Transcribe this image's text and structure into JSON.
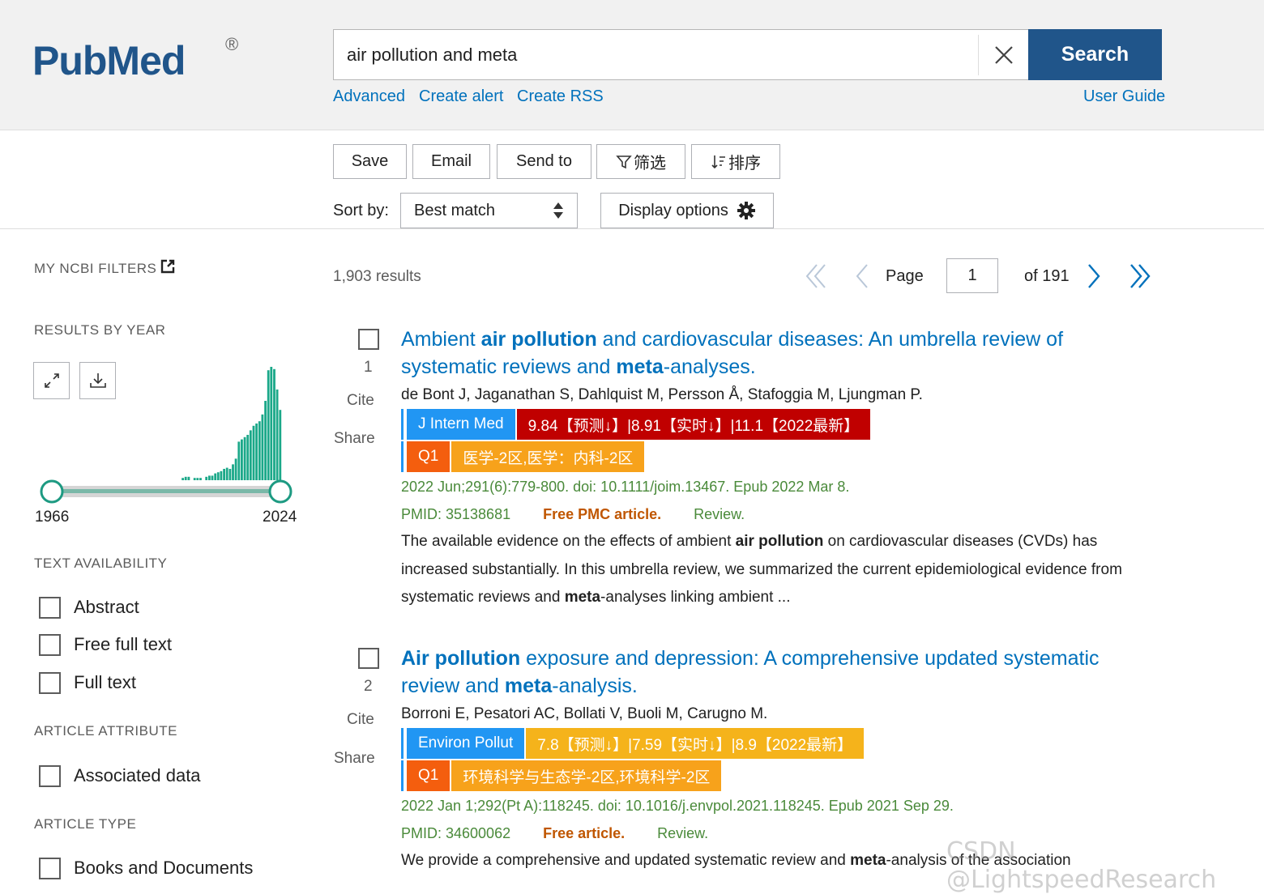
{
  "brand": {
    "logo_text": "PubMed",
    "registered": "®"
  },
  "search": {
    "value": "air pollution and meta",
    "button_label": "Search"
  },
  "header_links": {
    "advanced": "Advanced",
    "create_alert": "Create alert",
    "create_rss": "Create RSS",
    "user_guide": "User Guide"
  },
  "toolbar": {
    "save": "Save",
    "email": "Email",
    "send_to": "Send to",
    "filter": "筛选",
    "sort": "排序"
  },
  "sort": {
    "label": "Sort by:",
    "selected": "Best match",
    "display_options": "Display options"
  },
  "sidebar": {
    "my_filters": "MY NCBI FILTERS",
    "results_by_year": "RESULTS BY YEAR",
    "year_start": "1966",
    "year_end": "2024",
    "text_availability": "TEXT AVAILABILITY",
    "text_filters": [
      "Abstract",
      "Free full text",
      "Full text"
    ],
    "article_attribute": "ARTICLE ATTRIBUTE",
    "attribute_filters": [
      "Associated data"
    ],
    "article_type": "ARTICLE TYPE",
    "type_filters": [
      "Books and Documents"
    ]
  },
  "year_histogram": [
    0,
    0,
    0,
    0,
    0,
    0,
    0,
    0,
    0,
    0,
    0,
    0,
    0,
    0,
    0,
    0,
    0,
    0,
    0,
    0,
    0,
    0,
    0,
    0,
    0,
    0,
    0,
    0,
    0,
    0,
    0,
    0,
    0,
    0,
    0,
    0,
    0,
    0,
    0,
    0,
    0,
    0,
    0,
    0,
    0.02,
    0.03,
    0.03,
    0,
    0.02,
    0.02,
    0.02,
    0,
    0.03,
    0.04,
    0.04,
    0.06,
    0.07,
    0.08,
    0.1,
    0.11,
    0.1,
    0.14,
    0.19,
    0.34,
    0.36,
    0.38,
    0.4,
    0.44,
    0.48,
    0.5,
    0.52,
    0.58,
    0.7,
    0.97,
    1.0,
    0.98,
    0.8,
    0.62
  ],
  "pagination": {
    "results": "1,903 results",
    "page_label": "Page",
    "page_value": "1",
    "of_label": "of 191"
  },
  "results": [
    {
      "num": "1",
      "title_parts": [
        {
          "t": "Ambient ",
          "b": false
        },
        {
          "t": "air pollution",
          "b": true
        },
        {
          "t": " and cardiovascular diseases: An umbrella review of systematic reviews and ",
          "b": false
        },
        {
          "t": "meta",
          "b": true
        },
        {
          "t": "-analyses.",
          "b": false
        }
      ],
      "authors": "de Bont J, Jaganathan S, Dahlquist M, Persson Å, Stafoggia M, Ljungman P.",
      "journal": "J Intern Med",
      "impact": "9.84【预测↓】|8.91【实时↓】|11.1【2022最新】",
      "impact_color": "#c00000",
      "quartile": "Q1",
      "category": "医学-2区,医学：内科-2区",
      "citation": "2022 Jun;291(6):779-800. doi: 10.1111/joim.13467. Epub 2022 Mar 8.",
      "pmid": "PMID: 35138681",
      "free": "Free PMC article.",
      "type": "Review.",
      "snippet_parts": [
        {
          "t": "The available evidence on the effects of ambient ",
          "b": false
        },
        {
          "t": "air pollution",
          "b": true
        },
        {
          "t": " on cardiovascular diseases (CVDs) has increased substantially. In this umbrella review, we summarized the current epidemiological evidence from systematic reviews and ",
          "b": false
        },
        {
          "t": "meta",
          "b": true
        },
        {
          "t": "-analyses linking ambient ...",
          "b": false
        }
      ],
      "cite_label": "Cite",
      "share_label": "Share"
    },
    {
      "num": "2",
      "title_parts": [
        {
          "t": "Air pollution",
          "b": true
        },
        {
          "t": " exposure and depression: A comprehensive updated systematic review and ",
          "b": false
        },
        {
          "t": "meta",
          "b": true
        },
        {
          "t": "-analysis.",
          "b": false
        }
      ],
      "authors": "Borroni E, Pesatori AC, Bollati V, Buoli M, Carugno M.",
      "journal": "Environ Pollut",
      "impact": "7.8【预测↓】|7.59【实时↓】|8.9【2022最新】",
      "impact_color": "#f5b31b",
      "quartile": "Q1",
      "category": "环境科学与生态学-2区,环境科学-2区",
      "citation": "2022 Jan 1;292(Pt A):118245. doi: 10.1016/j.envpol.2021.118245. Epub 2021 Sep 29.",
      "pmid": "PMID: 34600062",
      "free": "Free article.",
      "type": "Review.",
      "snippet_parts": [
        {
          "t": "We provide a comprehensive and updated systematic review and ",
          "b": false
        },
        {
          "t": "meta",
          "b": true
        },
        {
          "t": "-analysis of the association",
          "b": false
        }
      ],
      "cite_label": "Cite",
      "share_label": "Share"
    }
  ],
  "colors": {
    "brand_blue": "#20558a",
    "link_blue": "#0071bc",
    "journal_badge": "#2196f3",
    "quartile_badge": "#f45e0e",
    "category_badge": "#f7a21b",
    "citation_green": "#4a8a3a",
    "free_orange": "#c05600"
  },
  "watermark": "CSDN @LightspeedResearch"
}
